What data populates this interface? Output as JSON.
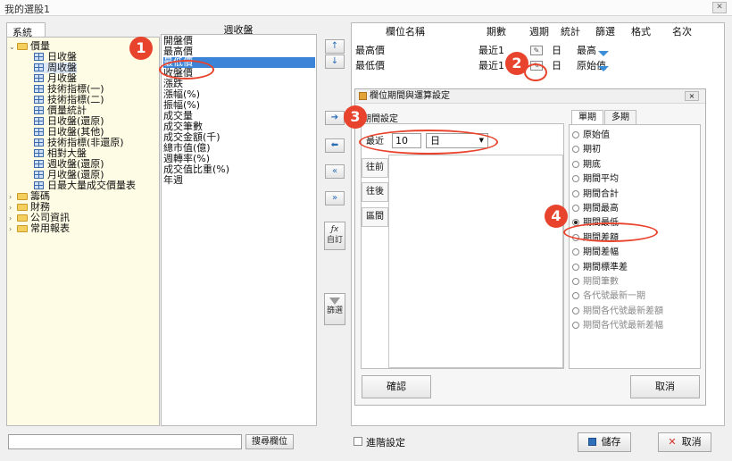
{
  "window": {
    "title": "我的選股1",
    "close_label": "✕"
  },
  "left_panel": {
    "tab_label": "系統",
    "tree": [
      {
        "label": "價量",
        "expanded": true,
        "children": [
          "日收盤",
          "周收盤",
          "月收盤",
          "技術指標(一)",
          "技術指標(二)",
          "價量統計",
          "日收盤(還原)",
          "日收盤(其他)",
          "技術指標(非還原)",
          "相對大盤",
          "週收盤(還原)",
          "月收盤(還原)",
          "日最大量成交價量表"
        ],
        "selected": "周收盤"
      },
      {
        "label": "籌碼"
      },
      {
        "label": "財務"
      },
      {
        "label": "公司資訊"
      },
      {
        "label": "常用報表"
      }
    ]
  },
  "field_list": {
    "header": "週收盤",
    "items": [
      "開盤價",
      "最高價",
      "最低價",
      "收盤價",
      "漲跌",
      "漲幅(%)",
      "振幅(%)",
      "成交量",
      "成交筆數",
      "成交金額(千)",
      "總市值(億)",
      "週轉率(%)",
      "成交值比重(%)",
      "年週"
    ],
    "selected": "最低價"
  },
  "arrows": {
    "up": "↑",
    "down": "↓",
    "right": "➔",
    "left": "⬅",
    "all_left": "«",
    "all_right": "»",
    "formula_icon": "ƒx",
    "formula_label": "自訂",
    "filter_label": "篩選"
  },
  "grid": {
    "columns": [
      "欄位名稱",
      "期數",
      "週期",
      "統計",
      "篩選",
      "格式",
      "名次"
    ],
    "rows": [
      {
        "name": "最高價",
        "period": "最近1",
        "cycle": "日",
        "stat": "最高"
      },
      {
        "name": "最低價",
        "period": "最近1",
        "cycle": "日",
        "stat": "原始值"
      }
    ]
  },
  "dialog": {
    "title": "欄位期間與運算設定",
    "close_label": "×",
    "period_section": "期間設定",
    "side_tabs": [
      "最近",
      "往前",
      "往後",
      "區間"
    ],
    "recent_value": "10",
    "recent_unit": "日",
    "stat_tabs": [
      "單期",
      "多期"
    ],
    "stats": [
      "原始值",
      "期初",
      "期底",
      "期間平均",
      "期間合計",
      "期間最高",
      "期間最低",
      "期間差額",
      "期間差幅",
      "期間標準差",
      "期間筆數",
      "各代號最新一期",
      "期間各代號最新差額",
      "期間各代號最新差幅"
    ],
    "selected_stat": "期間最低",
    "ok_label": "確認",
    "cancel_label": "取消"
  },
  "footer": {
    "search_button": "搜尋欄位",
    "advanced_label": "進階設定",
    "save_label": "儲存",
    "cancel_label": "取消"
  },
  "callouts": [
    "1",
    "2",
    "3",
    "4"
  ],
  "colors": {
    "accent": "#3b84d7",
    "callout": "#e8432c",
    "tree_bg": "#fffce5"
  }
}
